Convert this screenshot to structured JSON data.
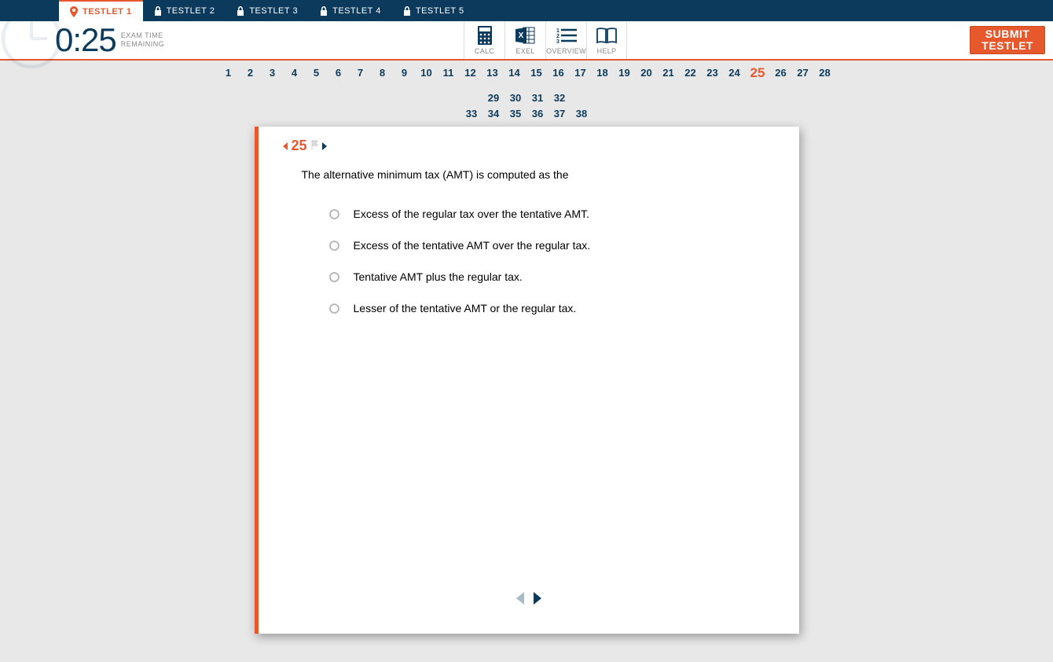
{
  "testlets": [
    {
      "label": "TESTLET 1",
      "active": true
    },
    {
      "label": "TESTLET 2",
      "active": false
    },
    {
      "label": "TESTLET 3",
      "active": false
    },
    {
      "label": "TESTLET 4",
      "active": false
    },
    {
      "label": "TESTLET 5",
      "active": false
    }
  ],
  "timer": {
    "value": "0:25",
    "label_line1": "EXAM TIME",
    "label_line2": "REMAINING"
  },
  "tools": {
    "calc": "CALC",
    "exel": "EXEL",
    "overview": "OVERVIEW",
    "help": "HELP"
  },
  "submit": {
    "line1": "SUBMIT",
    "line2": "TESTLET"
  },
  "question_nav": {
    "total": 38,
    "current": 25,
    "row1": [
      "1",
      "2",
      "3",
      "4",
      "5",
      "6",
      "7",
      "8",
      "9",
      "10",
      "11",
      "12",
      "13",
      "14",
      "15",
      "16",
      "17",
      "18",
      "19",
      "20",
      "21",
      "22",
      "23",
      "24",
      "25",
      "26",
      "27",
      "28",
      "29",
      "30",
      "31",
      "32"
    ],
    "row2": [
      "33",
      "34",
      "35",
      "36",
      "37",
      "38"
    ]
  },
  "question": {
    "number": "25",
    "prompt": "The alternative minimum tax (AMT) is computed as the",
    "answers": [
      "Excess of the regular tax over the tentative AMT.",
      "Excess of the tentative AMT over the regular tax.",
      "Tentative AMT plus the regular tax.",
      "Lesser of the tentative AMT or the regular tax."
    ]
  }
}
